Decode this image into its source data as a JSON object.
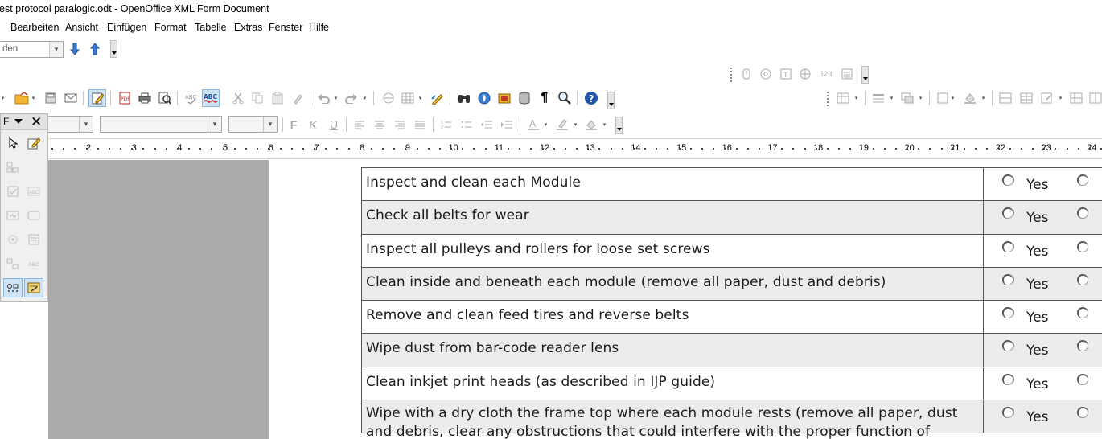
{
  "window": {
    "title": "est protocol paralogic.odt - OpenOffice XML Form Document"
  },
  "menu": [
    {
      "label": "Bearbeiten",
      "name": "menu-bearbeiten"
    },
    {
      "label": "Ansicht",
      "name": "menu-ansicht"
    },
    {
      "label": "Einfügen",
      "name": "menu-einfuegen"
    },
    {
      "label": "Format",
      "name": "menu-format"
    },
    {
      "label": "Tabelle",
      "name": "menu-tabelle"
    },
    {
      "label": "Extras",
      "name": "menu-extras"
    },
    {
      "label": "Fenster",
      "name": "menu-fenster"
    },
    {
      "label": "Hilfe",
      "name": "menu-hilfe"
    }
  ],
  "navigator": {
    "combo_value": "den"
  },
  "formatting": {
    "style_value": "",
    "font_value": "",
    "size_value": ""
  },
  "form_panel": {
    "title": "F"
  },
  "ruler": {
    "labels": [
      "2",
      "3",
      "4",
      "5",
      "6",
      "7",
      "8",
      "9",
      "10",
      "11",
      "12",
      "13",
      "14",
      "15",
      "16",
      "17",
      "18",
      "19",
      "20",
      "21",
      "22",
      "23",
      "24"
    ]
  },
  "secondary_toolbar": {
    "numeric_label": "123"
  },
  "table": {
    "rows": [
      {
        "text": "Inspect and clean each  Module",
        "option": "Yes"
      },
      {
        "text": "Check all belts for wear",
        "option": "Yes"
      },
      {
        "text": "Inspect all pulleys and rollers for loose set screws",
        "option": "Yes"
      },
      {
        "text": "Clean inside and beneath each module (remove all paper, dust and debris)",
        "option": "Yes"
      },
      {
        "text": "Remove and clean feed tires and reverse belts",
        "option": "Yes"
      },
      {
        "text": "Wipe dust from bar-code reader lens",
        "option": "Yes"
      },
      {
        "text": "Clean inkjet print heads (as described in IJP guide)",
        "option": "Yes"
      },
      {
        "text": "Wipe with a dry cloth the frame top where each module rests (remove all paper, dust and debris, clear any obstructions that could interfere with the proper function of",
        "option": "Yes"
      }
    ]
  },
  "colors": {
    "accent": "#2f6fbd",
    "gray_background": "#ababab",
    "alt_row": "#ececec"
  }
}
